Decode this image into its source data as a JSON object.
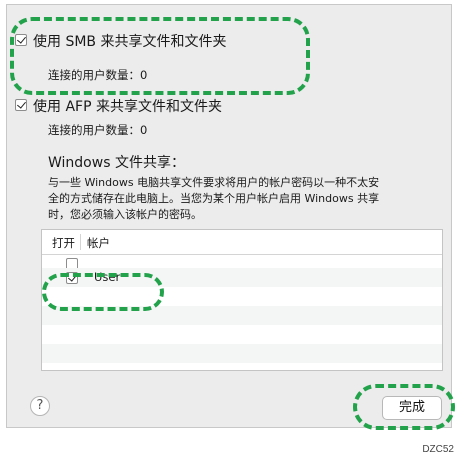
{
  "smb": {
    "label": "使用 SMB 来共享文件和文件夹",
    "checked": true,
    "users_label": "连接的用户数量：0"
  },
  "afp": {
    "label": "使用 AFP 来共享文件和文件夹",
    "checked": true,
    "users_label": "连接的用户数量：0"
  },
  "windows": {
    "title": "Windows 文件共享：",
    "desc_line1": "与一些 Windows 电脑共享文件要求将用户的帐户密码以一种不太安",
    "desc_line2": "全的方式储存在此电脑上。当您为某个用户帐户启用 Windows 共享",
    "desc_line3": "时，您必须输入该帐户的密码。"
  },
  "table": {
    "col_on": "打开",
    "col_account": "帐户",
    "rows": [
      {
        "on": false,
        "account": ""
      },
      {
        "on": true,
        "account": "User"
      }
    ]
  },
  "help_icon_glyph": "?",
  "done_label": "完成",
  "figure_code": "DZC52",
  "accent_color": "#22a24a"
}
